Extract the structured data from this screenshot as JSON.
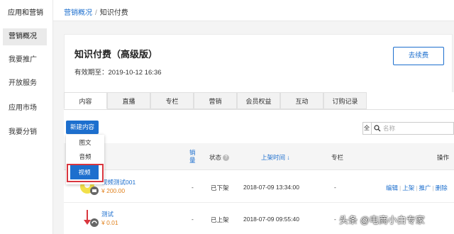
{
  "sidebar": {
    "title": "应用和营销",
    "items": [
      {
        "label": "营销概况",
        "active": true
      },
      {
        "label": "我要推广",
        "active": false
      },
      {
        "label": "开放服务",
        "active": false
      },
      {
        "label": "应用市场",
        "active": false
      },
      {
        "label": "我要分销",
        "active": false
      }
    ]
  },
  "breadcrumb": {
    "link": "营销概况",
    "separator": "/",
    "current": "知识付费"
  },
  "card": {
    "title": "知识付费（高级版）",
    "validity": "有效期至：2019-10-12 16:36",
    "renew_label": "去续费"
  },
  "tabs": [
    {
      "label": "内容",
      "active": true
    },
    {
      "label": "直播",
      "active": false
    },
    {
      "label": "专栏",
      "active": false
    },
    {
      "label": "营销",
      "active": false
    },
    {
      "label": "会员权益",
      "active": false
    },
    {
      "label": "互动",
      "active": false
    },
    {
      "label": "订购记录",
      "active": false
    }
  ],
  "new_button": "新建内容",
  "dropdown": {
    "items": [
      "图文",
      "音频",
      "视频"
    ],
    "selected": "视频"
  },
  "search": {
    "select_value": "全",
    "placeholder": "名称"
  },
  "table": {
    "headers": {
      "sales": "销量",
      "status": "状态",
      "listed_time": "上架时间 ↓",
      "column": "专栏",
      "ops": "操作"
    },
    "rows": [
      {
        "name": "视频测试001",
        "price": "¥ 200.00",
        "sales": "-",
        "status": "已下架",
        "time": "2018-07-09 13:34:00",
        "column": "-",
        "ops": [
          "编辑",
          "上架",
          "推广",
          "删除"
        ]
      },
      {
        "name": "测试",
        "price": "¥ 0.01",
        "sales": "-",
        "status": "已上架",
        "time": "2018-07-09 09:55:40",
        "column": "-",
        "ops": []
      }
    ]
  },
  "watermark": "头条 @电商小白专家",
  "colors": {
    "accent": "#1d6fce",
    "price": "#e0811d",
    "highlight": "#d9363e"
  }
}
